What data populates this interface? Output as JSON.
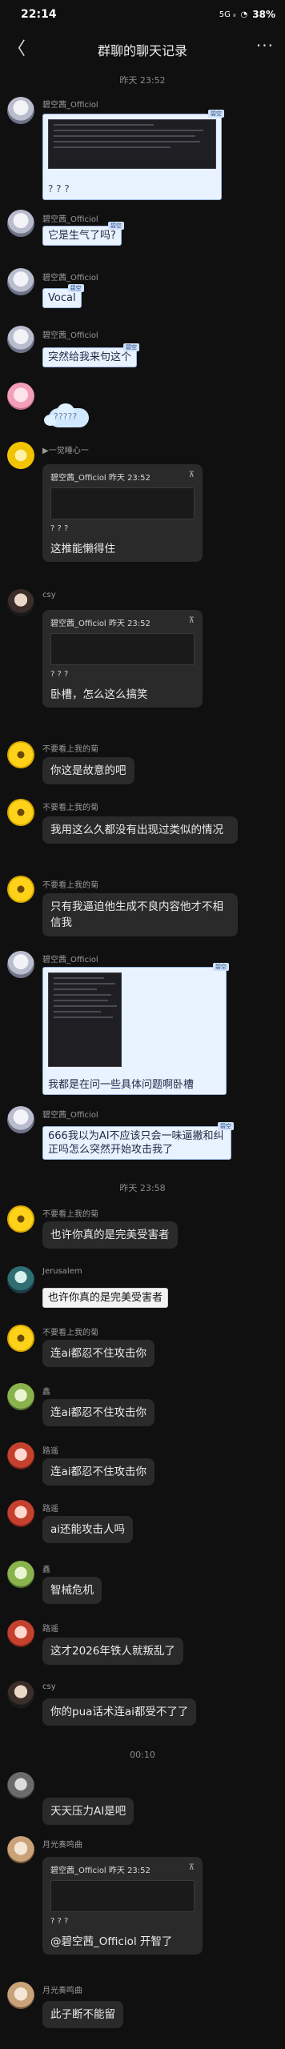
{
  "status_bar": {
    "time": "22:14",
    "signal": "5G ᵢₗ",
    "wifi": "◔",
    "battery": "38%"
  },
  "nav": {
    "back_icon": "chevron-left-icon",
    "title": "群聊的聊天记录",
    "more_icon": "more-icon",
    "back_glyph": "〈",
    "more_glyph": "···"
  },
  "dividers": [
    "昨天 23:52",
    "昨天 23:58",
    "00:10"
  ],
  "messages": [
    {
      "sender": "碧空茜_Officiol",
      "type": "screenshot",
      "caption": "? ? ?"
    },
    {
      "sender": "碧空茜_Officiol",
      "type": "light",
      "text": "它是生气了吗?",
      "tag": "碧空"
    },
    {
      "sender": "碧空茜_Officiol",
      "type": "light",
      "text": "Vocal",
      "tag": "碧空"
    },
    {
      "sender": "碧空茜_Officiol",
      "type": "light",
      "text": "突然给我来句这个",
      "tag": "碧空"
    },
    {
      "sender": "",
      "type": "sticker",
      "text": "?????"
    },
    {
      "sender": "▶一觉睡心一",
      "type": "quote",
      "head": "碧空茜_Officiol 昨天 23:52",
      "pin": "⊼",
      "q": "? ? ?",
      "caption": "这推能懒得住"
    },
    {
      "sender": "csy",
      "type": "quote",
      "head": "碧空茜_Officiol 昨天 23:52",
      "pin": "⊼",
      "q": "? ? ?",
      "caption": "卧槽，怎么这么搞笑"
    },
    {
      "sender": "不要看上我的菊",
      "type": "bubble",
      "text": "你这是故意的吧"
    },
    {
      "sender": "不要看上我的菊",
      "type": "bubble",
      "text": "我用这么久都没有出现过类似的情况"
    },
    {
      "sender": "不要看上我的菊",
      "type": "bubble",
      "text": "只有我逼迫他生成不良内容他才不相信我"
    },
    {
      "sender": "碧空茜_Officiol",
      "type": "screenshot2",
      "caption": "我都是在问一些具体问题啊卧槽",
      "tag": "碧空"
    },
    {
      "sender": "碧空茜_Officiol",
      "type": "light",
      "text": "666我以为AI不应该只会一味逼撇和纠正吗怎么突然开始攻击我了",
      "tag": "碧空"
    },
    {
      "sender": "不要看上我的菊",
      "type": "bubble",
      "text": "也许你真的是完美受害者"
    },
    {
      "sender": "Jerusalem",
      "type": "light",
      "text": "也许你真的是完美受害者",
      "tag": ""
    },
    {
      "sender": "不要看上我的菊",
      "type": "bubble",
      "text": "连ai都忍不住攻击你"
    },
    {
      "sender": "鑫",
      "type": "bubble",
      "text": "连ai都忍不住攻击你"
    },
    {
      "sender": "路遥",
      "type": "bubble",
      "text": "连ai都忍不住攻击你"
    },
    {
      "sender": "路遥",
      "type": "bubble",
      "text": "ai还能攻击人吗"
    },
    {
      "sender": "鑫",
      "type": "bubble",
      "text": "智械危机"
    },
    {
      "sender": "路遥",
      "type": "bubble",
      "text": "这才2026年铁人就叛乱了"
    },
    {
      "sender": "csy",
      "type": "bubble",
      "text": "你的pua话术连ai都受不了了"
    },
    {
      "sender": "",
      "type": "bubble",
      "text": "天天压力AI是吧"
    },
    {
      "sender": "月光奏鸣曲",
      "type": "quote",
      "head": "碧空茜_Officiol 昨天 23:52",
      "pin": "⊼",
      "q": "? ? ?",
      "caption": "@碧空茜_Officiol 开智了"
    },
    {
      "sender": "月光奏鸣曲",
      "type": "bubble",
      "text": "此子断不能留"
    }
  ]
}
